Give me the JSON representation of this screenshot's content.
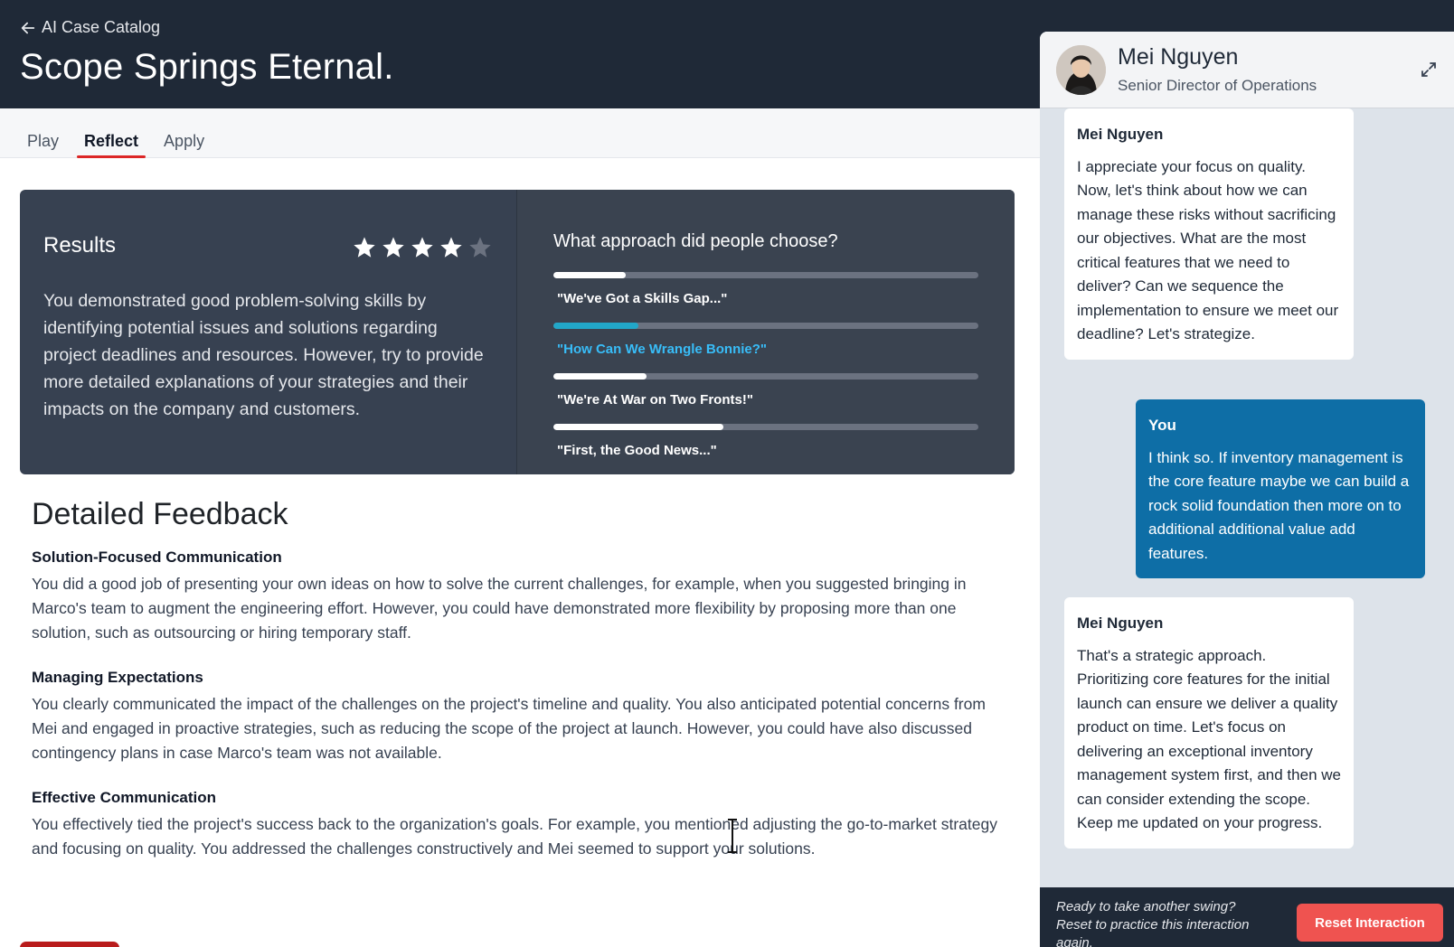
{
  "header": {
    "back_label": "AI Case Catalog",
    "title": "Scope Springs Eternal."
  },
  "tabs": [
    {
      "label": "Play",
      "active": false
    },
    {
      "label": "Reflect",
      "active": true
    },
    {
      "label": "Apply",
      "active": false
    }
  ],
  "results": {
    "title": "Results",
    "rating": 4,
    "rating_max": 5,
    "text": "You demonstrated good problem-solving skills by identifying potential issues and solutions regarding project deadlines and resources. However, try to provide more detailed explanations of your strategies and their impacts on the company and customers.",
    "poll": {
      "title": "What approach did people choose?",
      "options": [
        {
          "label": "\"We've Got a Skills Gap...\"",
          "fraction": 0.17,
          "selected": false
        },
        {
          "label": "\"How Can We Wrangle Bonnie?\"",
          "fraction": 0.2,
          "selected": true
        },
        {
          "label": "\"We're At War on Two Fronts!\"",
          "fraction": 0.22,
          "selected": false
        },
        {
          "label": "\"First, the Good News...\"",
          "fraction": 0.4,
          "selected": false
        }
      ]
    }
  },
  "feedback": {
    "title": "Detailed Feedback",
    "sections": [
      {
        "heading": "Solution-Focused Communication",
        "text": "You did a good job of presenting your own ideas on how to solve the current challenges, for example, when you suggested bringing in Marco's team to augment the engineering effort. However, you could have demonstrated more flexibility by proposing more than one solution, such as outsourcing or hiring temporary staff."
      },
      {
        "heading": "Managing Expectations",
        "text": "You clearly communicated the impact of the challenges on the project's timeline and quality. You also anticipated potential concerns from Mei and engaged in proactive strategies, such as reducing the scope of the project at launch. However, you could have also discussed contingency plans in case Marco's team was not available."
      },
      {
        "heading": "Effective Communication",
        "text": "You effectively tied the project's success back to the organization's goals. For example, you mentioned adjusting the go-to-market strategy and focusing on quality. You addressed the challenges constructively and Mei seemed to support your solutions."
      }
    ]
  },
  "chat": {
    "name": "Mei Nguyen",
    "role": "Senior Director of Operations",
    "messages": [
      {
        "author": "Mei Nguyen",
        "from": "bot",
        "text": "I appreciate your focus on quality. Now, let's think about how we can manage these risks without sacrificing our objectives. What are the most critical features that we need to deliver? Can we sequence the implementation to ensure we meet our deadline? Let's strategize."
      },
      {
        "author": "You",
        "from": "user",
        "text": "I think so. If inventory management is the core feature maybe we can build a rock solid foundation then more on to additional additional value add features."
      },
      {
        "author": "Mei Nguyen",
        "from": "bot",
        "text": "That's a strategic approach. Prioritizing core features for the initial launch can ensure we deliver a quality product on time. Let's focus on delivering an exceptional inventory management system first, and then we can consider extending the scope. Keep me updated on your progress."
      }
    ],
    "footer_text": "Ready to take another swing? Reset to practice this interaction again.",
    "reset_label": "Reset Interaction"
  },
  "icons": {
    "back": "arrow-left-icon",
    "expand": "expand-icon",
    "star": "star-icon"
  },
  "colors": {
    "header_bg": "#1f2937",
    "accent_red": "#dc2626",
    "poll_selected": "#22a7c8",
    "user_bubble": "#0e6ea6",
    "reset_button": "#ef5350"
  }
}
